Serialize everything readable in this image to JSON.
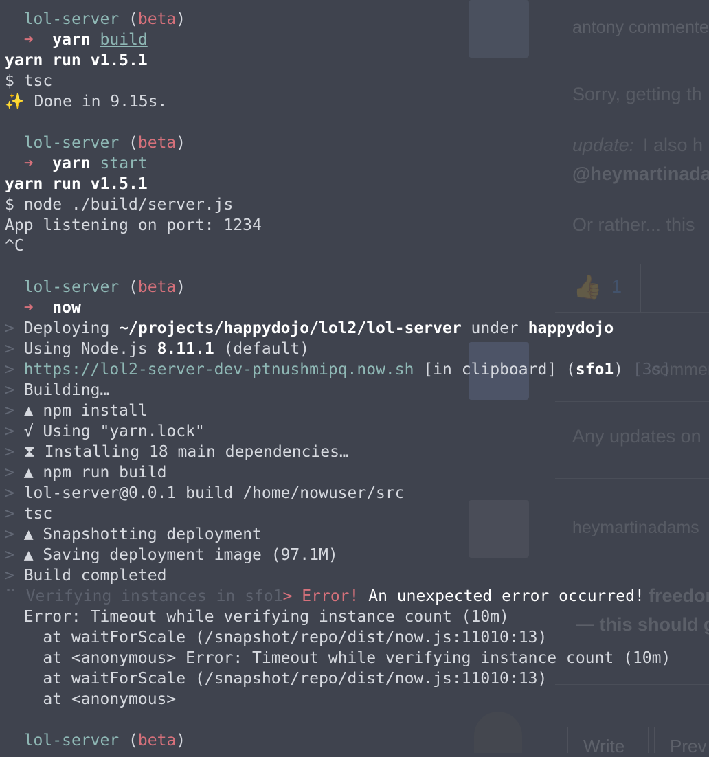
{
  "background_page": {
    "comment_header": "antony commented",
    "sorry": "Sorry, getting th",
    "update_label": "update:",
    "update_text": " I also h",
    "mention": "@heymartinadam",
    "or_rather": "Or rather... this",
    "reaction_emoji": "👍",
    "reaction_count": "1",
    "commented2": "commented",
    "any_updates": "Any updates on",
    "heymartinadams": "heymartinadams",
    "freedom": "freedom s",
    "this_should": "— this should g",
    "write_tab": "Write",
    "preview_tab": "Prev"
  },
  "terminal": {
    "lines": [
      {
        "segments": [
          {
            "t": "  "
          },
          {
            "t": "lol-server",
            "c": "teal"
          },
          {
            "t": " ("
          },
          {
            "t": "beta",
            "c": "pink"
          },
          {
            "t": ")"
          }
        ]
      },
      {
        "segments": [
          {
            "t": "  "
          },
          {
            "t": "➜",
            "c": "pink"
          },
          {
            "t": "  "
          },
          {
            "t": "yarn",
            "c": "w bold"
          },
          {
            "t": " "
          },
          {
            "t": "build",
            "c": "teal u"
          }
        ]
      },
      {
        "segments": [
          {
            "t": "yarn run v1.5.1",
            "c": "w bold"
          }
        ]
      },
      {
        "segments": [
          {
            "t": "$ tsc"
          }
        ]
      },
      {
        "segments": [
          {
            "t": "✨ Done in 9.15s."
          }
        ]
      },
      {
        "segments": [
          {
            "t": ""
          }
        ]
      },
      {
        "segments": [
          {
            "t": "  "
          },
          {
            "t": "lol-server",
            "c": "teal"
          },
          {
            "t": " ("
          },
          {
            "t": "beta",
            "c": "pink"
          },
          {
            "t": ")"
          }
        ]
      },
      {
        "segments": [
          {
            "t": "  "
          },
          {
            "t": "➜",
            "c": "pink"
          },
          {
            "t": "  "
          },
          {
            "t": "yarn",
            "c": "w bold"
          },
          {
            "t": " "
          },
          {
            "t": "start",
            "c": "teal"
          }
        ]
      },
      {
        "segments": [
          {
            "t": "yarn run v1.5.1",
            "c": "w bold"
          }
        ]
      },
      {
        "segments": [
          {
            "t": "$ node ./build/server.js"
          }
        ]
      },
      {
        "segments": [
          {
            "t": "App listening on port: 1234"
          }
        ]
      },
      {
        "segments": [
          {
            "t": "^C"
          }
        ]
      },
      {
        "segments": [
          {
            "t": ""
          }
        ]
      },
      {
        "segments": [
          {
            "t": "  "
          },
          {
            "t": "lol-server",
            "c": "teal"
          },
          {
            "t": " ("
          },
          {
            "t": "beta",
            "c": "pink"
          },
          {
            "t": ")"
          }
        ]
      },
      {
        "segments": [
          {
            "t": "  "
          },
          {
            "t": "➜",
            "c": "pink"
          },
          {
            "t": "  "
          },
          {
            "t": "now",
            "c": "w bold"
          }
        ]
      },
      {
        "segments": [
          {
            "t": ">",
            "c": "dim"
          },
          {
            "t": " Deploying "
          },
          {
            "t": "~/projects/happydojo/lol2/lol-server",
            "c": "w bold"
          },
          {
            "t": " under "
          },
          {
            "t": "happydojo",
            "c": "w bold"
          }
        ]
      },
      {
        "segments": [
          {
            "t": ">",
            "c": "dim"
          },
          {
            "t": " Using Node.js "
          },
          {
            "t": "8.11.1",
            "c": "w bold"
          },
          {
            "t": " (default)"
          }
        ]
      },
      {
        "segments": [
          {
            "t": ">",
            "c": "dim"
          },
          {
            "t": " "
          },
          {
            "t": "https://lol2-server-dev-ptnushmipq.now.sh",
            "c": "teal"
          },
          {
            "t": " [in clipboard] ("
          },
          {
            "t": "sfo1",
            "c": "w bold"
          },
          {
            "t": ") "
          },
          {
            "t": "[3s]",
            "c": "faint"
          }
        ]
      },
      {
        "segments": [
          {
            "t": ">",
            "c": "dim"
          },
          {
            "t": " Building…"
          }
        ]
      },
      {
        "segments": [
          {
            "t": ">",
            "c": "dim"
          },
          {
            "t": " ▲ npm install"
          }
        ]
      },
      {
        "segments": [
          {
            "t": ">",
            "c": "dim"
          },
          {
            "t": " √ Using \"yarn.lock\""
          }
        ]
      },
      {
        "segments": [
          {
            "t": ">",
            "c": "dim"
          },
          {
            "t": " ⧗ Installing 18 main dependencies…"
          }
        ]
      },
      {
        "segments": [
          {
            "t": ">",
            "c": "dim"
          },
          {
            "t": " ▲ npm run build"
          }
        ]
      },
      {
        "segments": [
          {
            "t": ">",
            "c": "dim"
          },
          {
            "t": " lol-server@0.0.1 build /home/nowuser/src"
          }
        ]
      },
      {
        "segments": [
          {
            "t": ">",
            "c": "dim"
          },
          {
            "t": " tsc"
          }
        ]
      },
      {
        "segments": [
          {
            "t": ">",
            "c": "dim"
          },
          {
            "t": " ▲ Snapshotting deployment"
          }
        ]
      },
      {
        "segments": [
          {
            "t": ">",
            "c": "dim"
          },
          {
            "t": " ▲ Saving deployment image (97.1M)"
          }
        ]
      },
      {
        "segments": [
          {
            "t": ">",
            "c": "dim"
          },
          {
            "t": " Build completed"
          }
        ]
      },
      {
        "segments": [
          {
            "t": "⠉",
            "c": "faint"
          },
          {
            "t": " Verifying instances in sfo1",
            "c": "faint"
          },
          {
            "t": "> Error!",
            "c": "pink"
          },
          {
            "t": " An unexpected error occurred!",
            "c": "w"
          }
        ]
      },
      {
        "segments": [
          {
            "t": "  Error: Timeout while verifying instance count (10m)"
          }
        ]
      },
      {
        "segments": [
          {
            "t": "    at waitForScale (/snapshot/repo/dist/now.js:11010:13)"
          }
        ]
      },
      {
        "segments": [
          {
            "t": "    at <anonymous> Error: Timeout while verifying instance count (10m)"
          }
        ]
      },
      {
        "segments": [
          {
            "t": "    at waitForScale (/snapshot/repo/dist/now.js:11010:13)"
          }
        ]
      },
      {
        "segments": [
          {
            "t": "    at <anonymous>"
          }
        ]
      },
      {
        "segments": [
          {
            "t": ""
          }
        ]
      },
      {
        "segments": [
          {
            "t": "  "
          },
          {
            "t": "lol-server",
            "c": "teal"
          },
          {
            "t": " ("
          },
          {
            "t": "beta",
            "c": "pink"
          },
          {
            "t": ")"
          }
        ]
      }
    ]
  }
}
